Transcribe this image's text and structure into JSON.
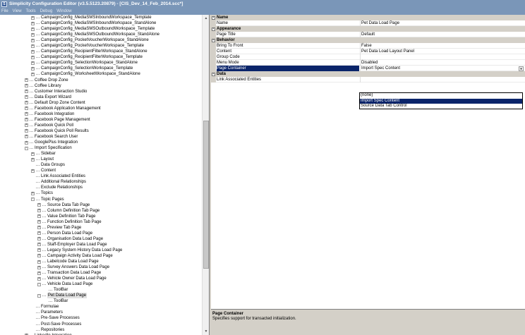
{
  "window": {
    "title": "Simplicity Configuration Editor (v3.5.5123.20879) - [CIS_Dev_14_Feb_2014.scc*]"
  },
  "menu": [
    "File",
    "View",
    "Tools",
    "Debug",
    "Window"
  ],
  "tree": [
    {
      "label": "CampaignConfig_MediaSMSInboundWorkspace_Template",
      "level": 1,
      "toggle": "+"
    },
    {
      "label": "CampaignConfig_MediaSMSInboundWorkspace_StandAlone",
      "level": 1,
      "toggle": "+"
    },
    {
      "label": "CampaignConfig_MediaSMSOutboundWorkspace_Template",
      "level": 1,
      "toggle": "+"
    },
    {
      "label": "CampaignConfig_MediaSMSOutboundWorkspace_StandAlone",
      "level": 1,
      "toggle": "+"
    },
    {
      "label": "CampaignConfig_PocketVoucherWorkspace_StandAlone",
      "level": 1,
      "toggle": "+"
    },
    {
      "label": "CampaignConfig_PocketVoucherWorkspace_Template",
      "level": 1,
      "toggle": "+"
    },
    {
      "label": "CampaignConfig_RecipientFilterWorkspace_StandAlone",
      "level": 1,
      "toggle": "+"
    },
    {
      "label": "CampaignConfig_RecipientFilterWorkspace_Template",
      "level": 1,
      "toggle": "+"
    },
    {
      "label": "CampaignConfig_SelectionWorkspace_StandAlone",
      "level": 1,
      "toggle": "+"
    },
    {
      "label": "CampaignConfig_SelectionWorkspace_Template",
      "level": 1,
      "toggle": "+"
    },
    {
      "label": "CampaignConfig_WorksheetWorkspace_StandAlone",
      "level": 1,
      "toggle": "+"
    },
    {
      "label": "Coffee Drop Zone",
      "level": 0,
      "toggle": "+"
    },
    {
      "label": "Coffee Library",
      "level": 0,
      "toggle": "+"
    },
    {
      "label": "Customer Interaction Studio",
      "level": 0,
      "toggle": "+"
    },
    {
      "label": "Data Export Wizard",
      "level": 0,
      "toggle": "+"
    },
    {
      "label": "Default Drop Zone Content",
      "level": 0,
      "toggle": "+"
    },
    {
      "label": "Facebook Application Management",
      "level": 0,
      "toggle": "+"
    },
    {
      "label": "Facebook Integration",
      "level": 0,
      "toggle": "+"
    },
    {
      "label": "Facebook Page Management",
      "level": 0,
      "toggle": "+"
    },
    {
      "label": "Facebook Quick Poll",
      "level": 0,
      "toggle": "+"
    },
    {
      "label": "Facebook Quick Poll Results",
      "level": 0,
      "toggle": "+"
    },
    {
      "label": "Facebook Search User",
      "level": 0,
      "toggle": "+"
    },
    {
      "label": "GooglePlus Integration",
      "level": 0,
      "toggle": "+"
    },
    {
      "label": "Import Specification",
      "level": 0,
      "toggle": "-"
    },
    {
      "label": "Sidebar",
      "level": 1,
      "toggle": "+"
    },
    {
      "label": "Layout",
      "level": 1,
      "toggle": "+"
    },
    {
      "label": "Data Groups",
      "level": 1,
      "toggle": ""
    },
    {
      "label": "Content",
      "level": 1,
      "toggle": "+"
    },
    {
      "label": "Link Associated Entities",
      "level": 1,
      "toggle": ""
    },
    {
      "label": "Additional Relationships",
      "level": 1,
      "toggle": ""
    },
    {
      "label": "Exclude Relationships",
      "level": 1,
      "toggle": ""
    },
    {
      "label": "Topics",
      "level": 1,
      "toggle": "+"
    },
    {
      "label": "Topic Pages",
      "level": 1,
      "toggle": "-"
    },
    {
      "label": "Source Data Tab Page",
      "level": 2,
      "toggle": "+"
    },
    {
      "label": "Column Definition Tab Page",
      "level": 2,
      "toggle": "+"
    },
    {
      "label": "Value Definition Tab Page",
      "level": 2,
      "toggle": "+"
    },
    {
      "label": "Function Definition Tab Page",
      "level": 2,
      "toggle": "+"
    },
    {
      "label": "Preview Tab Page",
      "level": 2,
      "toggle": "+"
    },
    {
      "label": "Person Data Load Page",
      "level": 2,
      "toggle": "+"
    },
    {
      "label": "Organisation Data Load Page",
      "level": 2,
      "toggle": "+"
    },
    {
      "label": "Staff-Employer Data Load Page",
      "level": 2,
      "toggle": "+"
    },
    {
      "label": "Legacy System History Data Load Page",
      "level": 2,
      "toggle": "+"
    },
    {
      "label": "Campaign Activity Data Load Page",
      "level": 2,
      "toggle": "+"
    },
    {
      "label": "Labelcode Data Load Page",
      "level": 2,
      "toggle": "+"
    },
    {
      "label": "Survey Answers Data Load Page",
      "level": 2,
      "toggle": "+"
    },
    {
      "label": "Transaction Data Load Page",
      "level": 2,
      "toggle": "+"
    },
    {
      "label": "Vehicle Owner Data Load Page",
      "level": 2,
      "toggle": "+"
    },
    {
      "label": "Vehicle Data Load Page",
      "level": 2,
      "toggle": "-"
    },
    {
      "label": "ToolBar",
      "level": 3,
      "toggle": ""
    },
    {
      "label": "Pet Data Load Page",
      "level": 2,
      "toggle": "-",
      "selected": true
    },
    {
      "label": "ToolBar",
      "level": 3,
      "toggle": ""
    },
    {
      "label": "Formulae",
      "level": 1,
      "toggle": ""
    },
    {
      "label": "Parameters",
      "level": 1,
      "toggle": ""
    },
    {
      "label": "Pre-Save Processes",
      "level": 1,
      "toggle": ""
    },
    {
      "label": "Post-Save Processes",
      "level": 1,
      "toggle": ""
    },
    {
      "label": "Repositories",
      "level": 1,
      "toggle": ""
    },
    {
      "label": "LinkedIn Integration",
      "level": 0,
      "toggle": "+"
    }
  ],
  "properties": [
    {
      "type": "category",
      "label": "Name"
    },
    {
      "type": "prop",
      "name": "Name",
      "value": "Pet Data Load Page"
    },
    {
      "type": "category",
      "label": "Appearance"
    },
    {
      "type": "prop",
      "name": "Page Title",
      "value": "Default"
    },
    {
      "type": "category",
      "label": "Behavior"
    },
    {
      "type": "prop",
      "name": "Bring To Front",
      "value": "False"
    },
    {
      "type": "prop",
      "name": "Content",
      "value": "Pet Data Load Layout Panel"
    },
    {
      "type": "prop",
      "name": "Group Code",
      "value": ""
    },
    {
      "type": "prop",
      "name": "Menu Mode",
      "value": "Disabled"
    },
    {
      "type": "prop",
      "name": "Page Container",
      "value": "Import Spec Content",
      "selected": true,
      "combo": true
    },
    {
      "type": "category",
      "label": "Data"
    },
    {
      "type": "prop",
      "name": "Link Associated Entities",
      "value": ""
    }
  ],
  "dropdown": {
    "options": [
      "(none)",
      "Import Spec Content",
      "Source Data Tab Control"
    ],
    "highlighted": 1
  },
  "description": {
    "title": "Page Container",
    "text": "Specifies support for transacted initialization."
  }
}
